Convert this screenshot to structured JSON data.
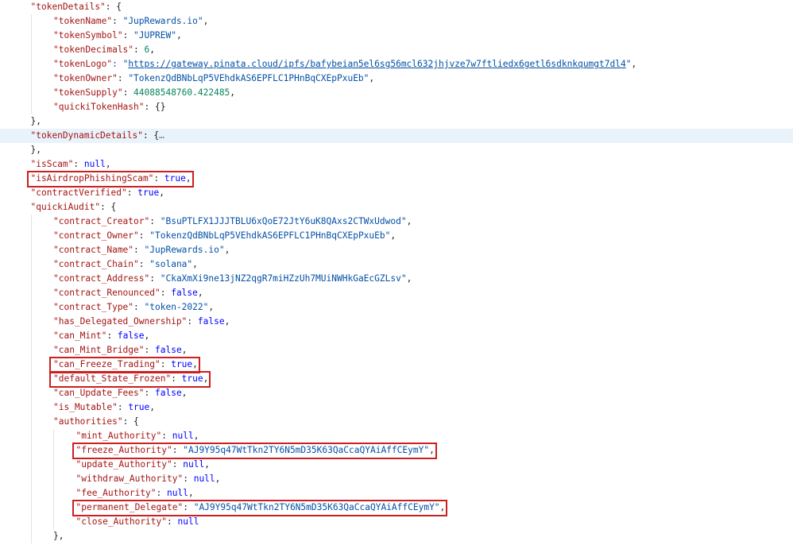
{
  "lines": [
    {
      "indent": 1,
      "parts": [
        {
          "t": "\"tokenDetails\"",
          "c": "k"
        },
        {
          "t": ": {",
          "c": "p"
        }
      ]
    },
    {
      "indent": 2,
      "parts": [
        {
          "t": "\"tokenName\"",
          "c": "k"
        },
        {
          "t": ": ",
          "c": "p"
        },
        {
          "t": "\"JupRewards.io\"",
          "c": "s"
        },
        {
          "t": ",",
          "c": "p"
        }
      ]
    },
    {
      "indent": 2,
      "parts": [
        {
          "t": "\"tokenSymbol\"",
          "c": "k"
        },
        {
          "t": ": ",
          "c": "p"
        },
        {
          "t": "\"JUPREW\"",
          "c": "s"
        },
        {
          "t": ",",
          "c": "p"
        }
      ]
    },
    {
      "indent": 2,
      "parts": [
        {
          "t": "\"tokenDecimals\"",
          "c": "k"
        },
        {
          "t": ": ",
          "c": "p"
        },
        {
          "t": "6",
          "c": "n"
        },
        {
          "t": ",",
          "c": "p"
        }
      ]
    },
    {
      "indent": 2,
      "parts": [
        {
          "t": "\"tokenLogo\"",
          "c": "k"
        },
        {
          "t": ": \"",
          "c": "s"
        },
        {
          "t": "https://gateway.pinata.cloud/ipfs/bafybeian5el6sg56mcl632jhjvze7w7ftliedx6getl6sdknkqumgt7dl4",
          "c": "u"
        },
        {
          "t": "\"",
          "c": "s"
        },
        {
          "t": ",",
          "c": "p"
        }
      ]
    },
    {
      "indent": 2,
      "parts": [
        {
          "t": "\"tokenOwner\"",
          "c": "k"
        },
        {
          "t": ": ",
          "c": "p"
        },
        {
          "t": "\"TokenzQdBNbLqP5VEhdkAS6EPFLC1PHnBqCXEpPxuEb\"",
          "c": "s"
        },
        {
          "t": ",",
          "c": "p"
        }
      ]
    },
    {
      "indent": 2,
      "parts": [
        {
          "t": "\"tokenSupply\"",
          "c": "k"
        },
        {
          "t": ": ",
          "c": "p"
        },
        {
          "t": "44088548760.422485",
          "c": "n"
        },
        {
          "t": ",",
          "c": "p"
        }
      ]
    },
    {
      "indent": 2,
      "parts": [
        {
          "t": "\"quickiTokenHash\"",
          "c": "k"
        },
        {
          "t": ": {}",
          "c": "p"
        }
      ]
    },
    {
      "indent": 1,
      "parts": [
        {
          "t": "},",
          "c": "p"
        }
      ]
    },
    {
      "indent": 1,
      "highlight": true,
      "parts": [
        {
          "t": "\"tokenDynamicDetails\"",
          "c": "k"
        },
        {
          "t": ": {",
          "c": "p"
        },
        {
          "t": "…",
          "c": "fold-dots"
        }
      ]
    },
    {
      "indent": 1,
      "parts": [
        {
          "t": "},",
          "c": "p"
        }
      ]
    },
    {
      "indent": 1,
      "parts": [
        {
          "t": "\"isScam\"",
          "c": "k"
        },
        {
          "t": ": ",
          "c": "p"
        },
        {
          "t": "null",
          "c": "kw"
        },
        {
          "t": ",",
          "c": "p"
        }
      ]
    },
    {
      "indent": 1,
      "parts": [
        {
          "t": "\"isAirdropPhishingScam\"",
          "c": "k"
        },
        {
          "t": ": ",
          "c": "p"
        },
        {
          "t": "true",
          "c": "kw"
        },
        {
          "t": ",",
          "c": "p"
        }
      ]
    },
    {
      "indent": 1,
      "parts": [
        {
          "t": "\"contractVerified\"",
          "c": "k"
        },
        {
          "t": ": ",
          "c": "p"
        },
        {
          "t": "true",
          "c": "kw"
        },
        {
          "t": ",",
          "c": "p"
        }
      ]
    },
    {
      "indent": 1,
      "parts": [
        {
          "t": "\"quickiAudit\"",
          "c": "k"
        },
        {
          "t": ": {",
          "c": "p"
        }
      ]
    },
    {
      "indent": 2,
      "parts": [
        {
          "t": "\"contract_Creator\"",
          "c": "k"
        },
        {
          "t": ": ",
          "c": "p"
        },
        {
          "t": "\"BsuPTLFX1JJJTBLU6xQoE72JtY6uK8QAxs2CTWxUdwod\"",
          "c": "s"
        },
        {
          "t": ",",
          "c": "p"
        }
      ]
    },
    {
      "indent": 2,
      "parts": [
        {
          "t": "\"contract_Owner\"",
          "c": "k"
        },
        {
          "t": ": ",
          "c": "p"
        },
        {
          "t": "\"TokenzQdBNbLqP5VEhdkAS6EPFLC1PHnBqCXEpPxuEb\"",
          "c": "s"
        },
        {
          "t": ",",
          "c": "p"
        }
      ]
    },
    {
      "indent": 2,
      "parts": [
        {
          "t": "\"contract_Name\"",
          "c": "k"
        },
        {
          "t": ": ",
          "c": "p"
        },
        {
          "t": "\"JupRewards.io\"",
          "c": "s"
        },
        {
          "t": ",",
          "c": "p"
        }
      ]
    },
    {
      "indent": 2,
      "parts": [
        {
          "t": "\"contract_Chain\"",
          "c": "k"
        },
        {
          "t": ": ",
          "c": "p"
        },
        {
          "t": "\"solana\"",
          "c": "s"
        },
        {
          "t": ",",
          "c": "p"
        }
      ]
    },
    {
      "indent": 2,
      "parts": [
        {
          "t": "\"contract_Address\"",
          "c": "k"
        },
        {
          "t": ": ",
          "c": "p"
        },
        {
          "t": "\"CkaXmXi9ne13jNZ2qgR7miHZzUh7MUiNWHkGaEcGZLsv\"",
          "c": "s"
        },
        {
          "t": ",",
          "c": "p"
        }
      ]
    },
    {
      "indent": 2,
      "parts": [
        {
          "t": "\"contract_Renounced\"",
          "c": "k"
        },
        {
          "t": ": ",
          "c": "p"
        },
        {
          "t": "false",
          "c": "kw"
        },
        {
          "t": ",",
          "c": "p"
        }
      ]
    },
    {
      "indent": 2,
      "parts": [
        {
          "t": "\"contract_Type\"",
          "c": "k"
        },
        {
          "t": ": ",
          "c": "p"
        },
        {
          "t": "\"token-2022\"",
          "c": "s"
        },
        {
          "t": ",",
          "c": "p"
        }
      ]
    },
    {
      "indent": 2,
      "parts": [
        {
          "t": "\"has_Delegated_Ownership\"",
          "c": "k"
        },
        {
          "t": ": ",
          "c": "p"
        },
        {
          "t": "false",
          "c": "kw"
        },
        {
          "t": ",",
          "c": "p"
        }
      ]
    },
    {
      "indent": 2,
      "parts": [
        {
          "t": "\"can_Mint\"",
          "c": "k"
        },
        {
          "t": ": ",
          "c": "p"
        },
        {
          "t": "false",
          "c": "kw"
        },
        {
          "t": ",",
          "c": "p"
        }
      ]
    },
    {
      "indent": 2,
      "parts": [
        {
          "t": "\"can_Mint_Bridge\"",
          "c": "k"
        },
        {
          "t": ": ",
          "c": "p"
        },
        {
          "t": "false",
          "c": "kw"
        },
        {
          "t": ",",
          "c": "p"
        }
      ]
    },
    {
      "indent": 2,
      "parts": [
        {
          "t": "\"can_Freeze_Trading\"",
          "c": "k"
        },
        {
          "t": ": ",
          "c": "p"
        },
        {
          "t": "true",
          "c": "kw"
        },
        {
          "t": ",",
          "c": "p"
        }
      ]
    },
    {
      "indent": 2,
      "parts": [
        {
          "t": "\"default_State_Frozen\"",
          "c": "k"
        },
        {
          "t": ": ",
          "c": "p"
        },
        {
          "t": "true",
          "c": "kw"
        },
        {
          "t": ",",
          "c": "p"
        }
      ]
    },
    {
      "indent": 2,
      "parts": [
        {
          "t": "\"can_Update_Fees\"",
          "c": "k"
        },
        {
          "t": ": ",
          "c": "p"
        },
        {
          "t": "false",
          "c": "kw"
        },
        {
          "t": ",",
          "c": "p"
        }
      ]
    },
    {
      "indent": 2,
      "parts": [
        {
          "t": "\"is_Mutable\"",
          "c": "k"
        },
        {
          "t": ": ",
          "c": "p"
        },
        {
          "t": "true",
          "c": "kw"
        },
        {
          "t": ",",
          "c": "p"
        }
      ]
    },
    {
      "indent": 2,
      "parts": [
        {
          "t": "\"authorities\"",
          "c": "k"
        },
        {
          "t": ": {",
          "c": "p"
        }
      ]
    },
    {
      "indent": 3,
      "parts": [
        {
          "t": "\"mint_Authority\"",
          "c": "k"
        },
        {
          "t": ": ",
          "c": "p"
        },
        {
          "t": "null",
          "c": "kw"
        },
        {
          "t": ",",
          "c": "p"
        }
      ]
    },
    {
      "indent": 3,
      "parts": [
        {
          "t": "\"freeze_Authority\"",
          "c": "k"
        },
        {
          "t": ": ",
          "c": "p"
        },
        {
          "t": "\"AJ9Y95q47WtTkn2TY6N5mD35K63QaCcaQYAiAffCEymY\"",
          "c": "s"
        },
        {
          "t": ",",
          "c": "p"
        }
      ]
    },
    {
      "indent": 3,
      "parts": [
        {
          "t": "\"update_Authority\"",
          "c": "k"
        },
        {
          "t": ": ",
          "c": "p"
        },
        {
          "t": "null",
          "c": "kw"
        },
        {
          "t": ",",
          "c": "p"
        }
      ]
    },
    {
      "indent": 3,
      "parts": [
        {
          "t": "\"withdraw_Authority\"",
          "c": "k"
        },
        {
          "t": ": ",
          "c": "p"
        },
        {
          "t": "null",
          "c": "kw"
        },
        {
          "t": ",",
          "c": "p"
        }
      ]
    },
    {
      "indent": 3,
      "parts": [
        {
          "t": "\"fee_Authority\"",
          "c": "k"
        },
        {
          "t": ": ",
          "c": "p"
        },
        {
          "t": "null",
          "c": "kw"
        },
        {
          "t": ",",
          "c": "p"
        }
      ]
    },
    {
      "indent": 3,
      "parts": [
        {
          "t": "\"permanent_Delegate\"",
          "c": "k"
        },
        {
          "t": ": ",
          "c": "p"
        },
        {
          "t": "\"AJ9Y95q47WtTkn2TY6N5mD35K63QaCcaQYAiAffCEymY\"",
          "c": "s"
        },
        {
          "t": ",",
          "c": "p"
        }
      ]
    },
    {
      "indent": 3,
      "parts": [
        {
          "t": "\"close_Authority\"",
          "c": "k"
        },
        {
          "t": ": ",
          "c": "p"
        },
        {
          "t": "null",
          "c": "kw"
        }
      ]
    },
    {
      "indent": 2,
      "parts": [
        {
          "t": "},",
          "c": "p"
        }
      ]
    }
  ],
  "highlights": [
    {
      "line": 12,
      "span": "key-value"
    },
    {
      "line": 25,
      "span": "key-value"
    },
    {
      "line": 26,
      "span": "key-value"
    },
    {
      "line": 31,
      "span": "key-value"
    },
    {
      "line": 35,
      "span": "key-value"
    }
  ]
}
